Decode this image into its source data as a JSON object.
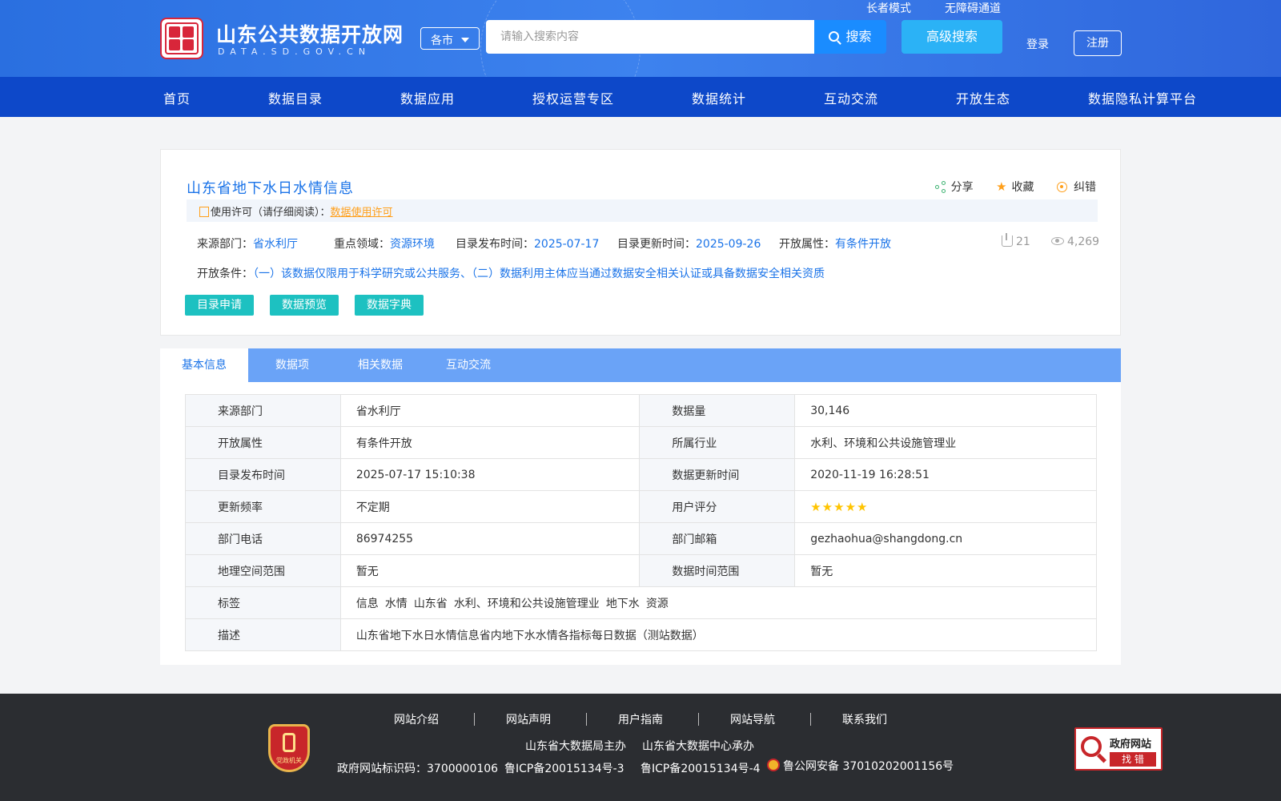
{
  "header": {
    "site_title": "山东公共数据开放网",
    "site_subtitle": "DATA.SD.GOV.CN",
    "city_select": "各市",
    "search_placeholder": "请输入搜索内容",
    "search_button": "搜索",
    "advanced_search": "高级搜索",
    "elder_mode": "长者模式",
    "accessibility": "无障碍通道",
    "login": "登录",
    "register": "注册"
  },
  "nav": [
    "首页",
    "数据目录",
    "数据应用",
    "授权运营专区",
    "数据统计",
    "互动交流",
    "开放生态",
    "数据隐私计算平台"
  ],
  "dataset": {
    "title": "山东省地下水日水情信息",
    "share": "分享",
    "favorite": "收藏",
    "report": "纠错",
    "license_label": "使用许可（请仔细阅读）：",
    "license_link": "数据使用许可",
    "source_label": "来源部门：",
    "source_value": "省水利厅",
    "domain_label": "重点领域：",
    "domain_value": "资源环境",
    "publish_label": "目录发布时间：",
    "publish_value": "2025-07-17",
    "update_label": "目录更新时间：",
    "update_value": "2025-09-26",
    "open_label": "开放属性：",
    "open_value": "有条件开放",
    "downloads": "21",
    "views": "4,269",
    "condition_label": "开放条件：",
    "condition_value": "（一）该数据仅限用于科学研究或公共服务、（二）数据利用主体应当通过数据安全相关认证或具备数据安全相关资质",
    "btn_apply": "目录申请",
    "btn_preview": "数据预览",
    "btn_dictionary": "数据字典"
  },
  "tabs": [
    "基本信息",
    "数据项",
    "相关数据",
    "互动交流"
  ],
  "info": {
    "rows": [
      {
        "k1": "来源部门",
        "v1": "省水利厅",
        "k2": "数据量",
        "v2": "30,146"
      },
      {
        "k1": "开放属性",
        "v1": "有条件开放",
        "k2": "所属行业",
        "v2": "水利、环境和公共设施管理业"
      },
      {
        "k1": "目录发布时间",
        "v1": "2025-07-17 15:10:38",
        "k2": "数据更新时间",
        "v2": "2020-11-19 16:28:51"
      },
      {
        "k1": "更新频率",
        "v1": "不定期",
        "k2": "用户评分",
        "v2": ""
      },
      {
        "k1": "部门电话",
        "v1": "86974255",
        "k2": "部门邮箱",
        "v2": "gezhaohua@shangdong.cn"
      },
      {
        "k1": "地理空间范围",
        "v1": "暂无",
        "k2": "数据时间范围",
        "v2": "暂无"
      }
    ],
    "rating": 5,
    "tags_label": "标签",
    "tags": [
      "信息",
      "水情",
      "山东省",
      "水利、环境和公共设施管理业",
      "地下水",
      "资源"
    ],
    "desc_label": "描述",
    "desc_value": "山东省地下水日水情信息省内地下水水情各指标每日数据（测站数据）"
  },
  "footer": {
    "links": [
      "网站介绍",
      "网站声明",
      "用户指南",
      "网站导航",
      "联系我们"
    ],
    "host": "山东省大数据局主办",
    "organizer": "山东省大数据中心承办",
    "site_id": "政府网站标识码：3700000106",
    "icp1": "鲁ICP备20015134号-3",
    "icp2": "鲁ICP备20015134号-4",
    "police": "鲁公网安备 37010202001156号",
    "party_badge": "党政机关",
    "gov_error_title": "政府网站",
    "gov_error_sub": "找 错"
  }
}
